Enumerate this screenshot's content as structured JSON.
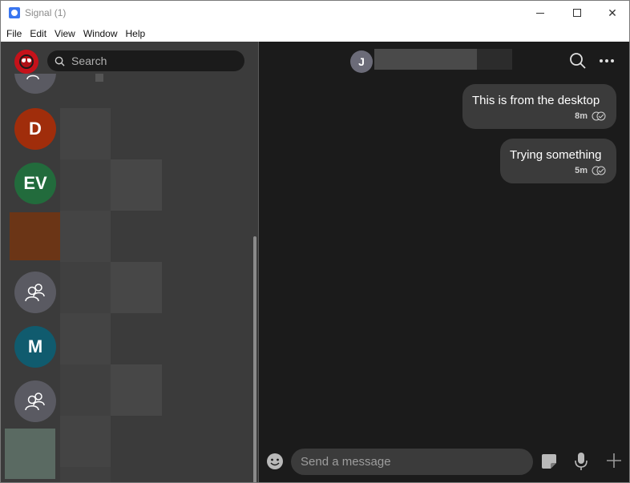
{
  "window": {
    "title": "Signal (1)",
    "controls": {
      "minimize": "minimize",
      "maximize": "maximize",
      "close": "✕"
    }
  },
  "menu": {
    "items": [
      "File",
      "Edit",
      "View",
      "Window",
      "Help"
    ]
  },
  "sidebar": {
    "search_placeholder": "Search",
    "conversations": [
      {
        "initials": "",
        "avatar": "group-avatar-partial",
        "color": "#5a5a62"
      },
      {
        "initials": "D",
        "color": "#a02d0b"
      },
      {
        "initials": "EV",
        "color": "#226b3c"
      },
      {
        "initials": "",
        "avatar": "square-thumbnail",
        "color": "#6b3516"
      },
      {
        "initials": "",
        "avatar": "group-icon",
        "color": "#5a5a62"
      },
      {
        "initials": "M",
        "color": "#105b6e"
      },
      {
        "initials": "",
        "avatar": "group-icon",
        "color": "#5a5a62"
      },
      {
        "initials": "",
        "avatar": "square-thumbnail",
        "color": "#5a6a62"
      }
    ]
  },
  "conversation": {
    "header_initial": "J",
    "messages": [
      {
        "text": "This is from the desktop",
        "time": "8m",
        "status": "delivered"
      },
      {
        "text": "Trying something",
        "time": "5m",
        "status": "delivered"
      }
    ],
    "compose_placeholder": "Send a message"
  },
  "colors": {
    "sidebar_bg": "#3b3b3b",
    "conversation_bg": "#1b1b1b",
    "bubble_bg": "#3b3b3b",
    "search_bg": "#1b1b1b"
  }
}
